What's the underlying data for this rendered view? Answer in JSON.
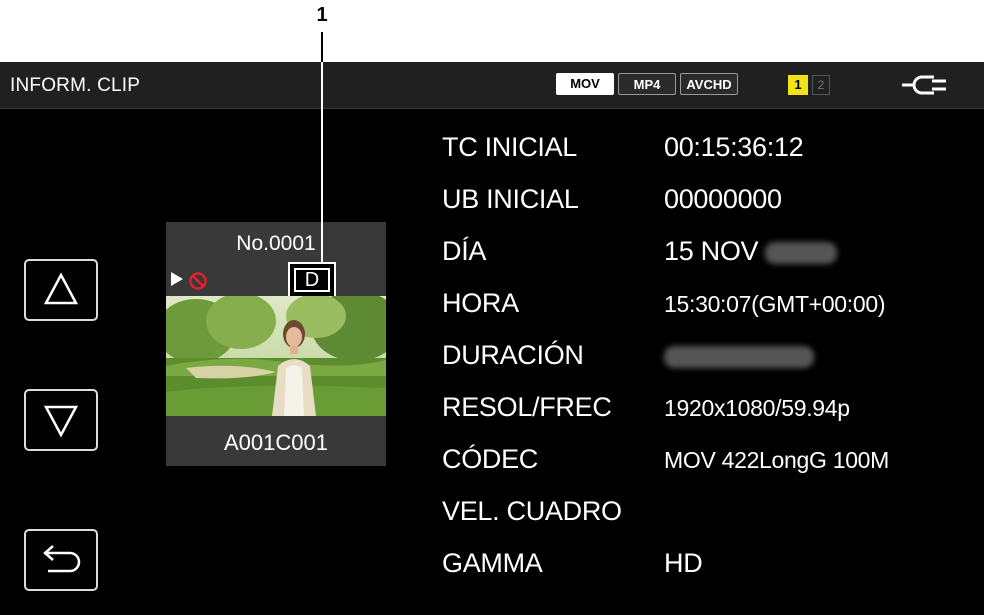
{
  "callout": {
    "number": "1"
  },
  "header": {
    "title": "INFORM. CLIP",
    "formats": [
      "MOV",
      "MP4",
      "AVCHD"
    ],
    "slots": [
      "1",
      "2"
    ]
  },
  "clip": {
    "number": "No.0001",
    "badge": "D",
    "name": "A001C001"
  },
  "info": [
    {
      "label": "TC INICIAL",
      "value": "00:15:36:12"
    },
    {
      "label": "UB INICIAL",
      "value": "00000000"
    },
    {
      "label": "DÍA",
      "value": "15 NOV"
    },
    {
      "label": "HORA",
      "value": "15:30:07(GMT+00:00)"
    },
    {
      "label": "DURACIÓN",
      "value": ""
    },
    {
      "label": "RESOL/FREC",
      "value": "1920x1080/59.94p"
    },
    {
      "label": "CÓDEC",
      "value": "MOV 422LongG 100M"
    },
    {
      "label": "VEL. CUADRO",
      "value": ""
    },
    {
      "label": "GAMMA",
      "value": "HD"
    }
  ],
  "colors": {
    "screen_bg": "#000000",
    "header_bg": "#202020",
    "slot_active": "#f2e218",
    "no_entry": "#e0202a"
  }
}
